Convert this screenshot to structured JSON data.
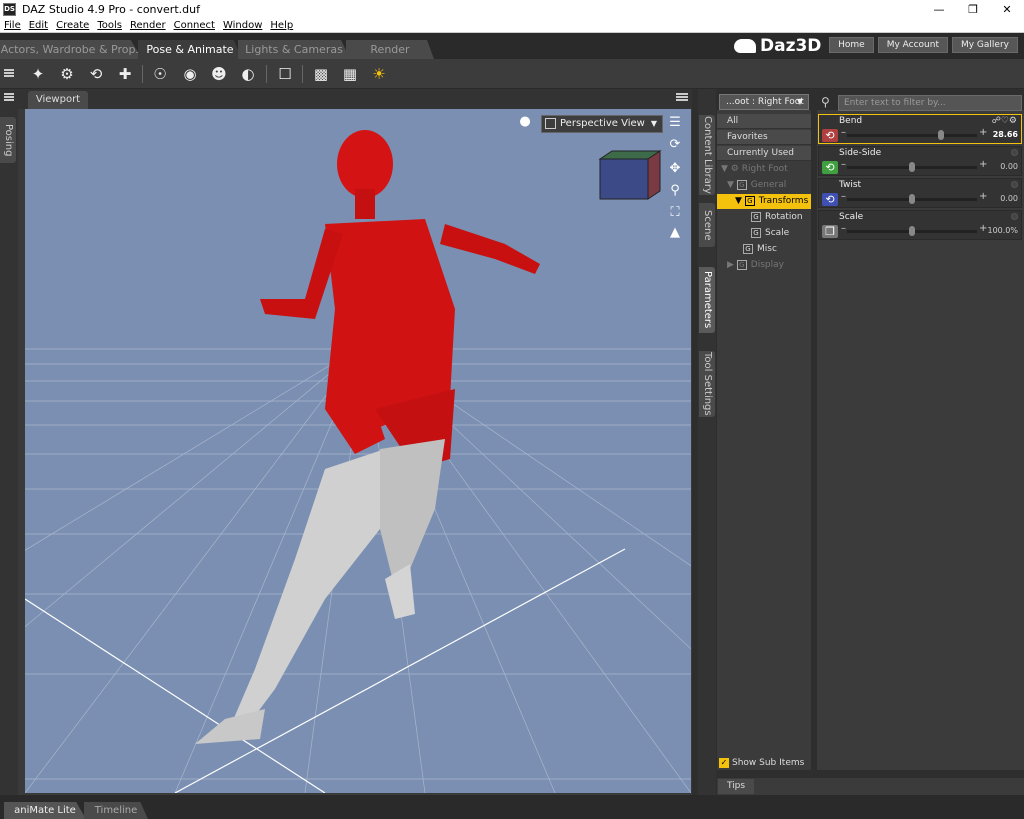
{
  "window": {
    "title": "DAZ Studio 4.9 Pro - convert.duf",
    "app_icon": "DS"
  },
  "menu": [
    "File",
    "Edit",
    "Create",
    "Tools",
    "Render",
    "Connect",
    "Window",
    "Help"
  ],
  "pane_tabs": [
    "Actors, Wardrobe & Props",
    "Pose & Animate",
    "Lights & Cameras",
    "Render"
  ],
  "brand": {
    "logo_text": "Daz3D",
    "links": [
      "Home",
      "My Account",
      "My Gallery"
    ]
  },
  "left_strip": {
    "tab": "Posing"
  },
  "viewport": {
    "tab": "Viewport",
    "view_select": "Perspective View",
    "background_color": "#7a8fb2"
  },
  "side_tabs": [
    "Content Library",
    "Scene",
    "Parameters",
    "Tool Settings"
  ],
  "parameters": {
    "node_select": "...oot : Right Foot",
    "filter_placeholder": "Enter text to filter by...",
    "tree": {
      "all": "All",
      "favorites": "Favorites",
      "currently_used": "Currently Used",
      "right_foot": "Right Foot",
      "general": "General",
      "transforms": "Transforms",
      "rotation": "Rotation",
      "scale": "Scale",
      "misc": "Misc",
      "display": "Display"
    },
    "rows": [
      {
        "label": "Bend",
        "value": "28.66",
        "fraction": 0.72,
        "color": "#b04040"
      },
      {
        "label": "Side-Side",
        "value": "0.00",
        "fraction": 0.5,
        "color": "#40a040"
      },
      {
        "label": "Twist",
        "value": "0.00",
        "fraction": 0.5,
        "color": "#4050b0"
      },
      {
        "label": "Scale",
        "value": "100.0%",
        "fraction": 0.5,
        "color": "#777777"
      }
    ],
    "show_sub_items": "Show Sub Items"
  },
  "tips_tab": "Tips",
  "bottom_tabs": [
    "aniMate Lite",
    "Timeline"
  ],
  "accent": "#f4c20d"
}
